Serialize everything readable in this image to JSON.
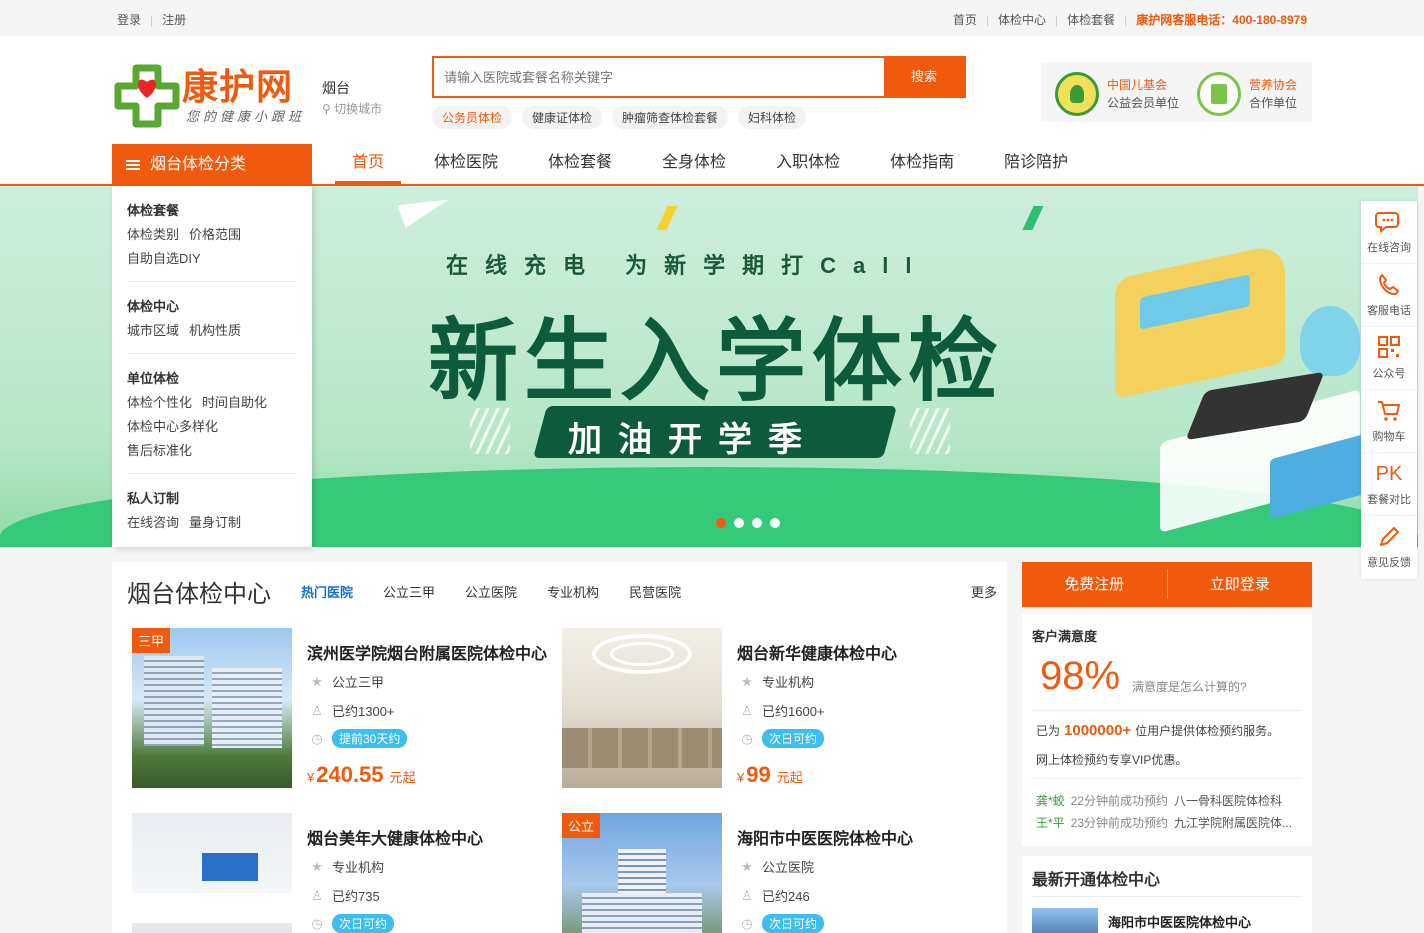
{
  "topbar": {
    "login": "登录",
    "register": "注册",
    "links": [
      "首页",
      "体检中心",
      "体检套餐"
    ],
    "hotline": "康护网客服电话：400-180-8979"
  },
  "header": {
    "logo_text": "康护网",
    "logo_slogan": "您的健康小跟班",
    "city": "烟台",
    "city_switch": "切换城市",
    "search_placeholder": "请输入医院或套餐名称关键字",
    "search_button": "搜索",
    "hot_tags": [
      "公务员体检",
      "健康证体检",
      "肿瘤筛查体检套餐",
      "妇科体检"
    ],
    "partners": [
      {
        "line1": "中国儿基会",
        "line2": "公益会员单位"
      },
      {
        "line1": "营养协会",
        "line2": "合作单位"
      }
    ]
  },
  "nav": {
    "category_title": "烟台体检分类",
    "items": [
      "首页",
      "体检医院",
      "体检套餐",
      "全身体检",
      "入职体检",
      "体检指南",
      "陪诊陪护"
    ]
  },
  "categories": [
    {
      "title": "体检套餐",
      "rows": [
        [
          "体检类别",
          "价格范围"
        ],
        [
          "自助自选DIY"
        ]
      ]
    },
    {
      "title": "体检中心",
      "rows": [
        [
          "城市区域",
          "机构性质"
        ]
      ]
    },
    {
      "title": "单位体检",
      "rows": [
        [
          "体检个性化",
          "时间自助化"
        ],
        [
          "体检中心多样化"
        ],
        [
          "售后标准化"
        ]
      ]
    },
    {
      "title": "私人订制",
      "rows": [
        [
          "在线咨询",
          "量身订制"
        ]
      ]
    }
  ],
  "banner": {
    "subtitle": "在线充电 为新学期打Call",
    "title": "新生入学体检",
    "ribbon": "加油开学季",
    "slide_count": 4,
    "active_slide": 1
  },
  "sidebar": [
    {
      "label": "在线咨询",
      "icon": "chat-icon"
    },
    {
      "label": "客服电话",
      "icon": "phone-icon"
    },
    {
      "label": "公众号",
      "icon": "qrcode-icon"
    },
    {
      "label": "购物车",
      "icon": "cart-icon"
    },
    {
      "label": "套餐对比",
      "icon": "pk-icon",
      "glyph": "PK"
    },
    {
      "label": "意见反馈",
      "icon": "pencil-icon"
    }
  ],
  "hospitals": {
    "title": "烟台体检中心",
    "tabs": [
      "热门医院",
      "公立三甲",
      "公立医院",
      "专业机构",
      "民营医院"
    ],
    "more": "更多",
    "cards": [
      {
        "badge": "三甲",
        "name": "滨州医学院烟台附属医院体检中心",
        "type": "公立三甲",
        "booked": "已约1300+",
        "availability": "提前30天约",
        "currency": "¥",
        "price": "240.55",
        "unit": "元起"
      },
      {
        "badge": "",
        "name": "烟台新华健康体检中心",
        "type": "专业机构",
        "booked": "已约1600+",
        "availability": "次日可约",
        "currency": "¥",
        "price": "99",
        "unit": "元起"
      },
      {
        "badge": "",
        "name": "烟台美年大健康体检中心",
        "type": "专业机构",
        "booked": "已约735",
        "availability": "次日可约",
        "currency": "¥",
        "price": "",
        "unit": ""
      },
      {
        "badge": "公立",
        "name": "海阳市中医医院体检中心",
        "type": "公立医院",
        "booked": "已约246",
        "availability": "次日可约",
        "currency": "¥",
        "price": "",
        "unit": ""
      }
    ]
  },
  "account": {
    "register": "免费注册",
    "login": "立即登录"
  },
  "satisfaction": {
    "title": "客户满意度",
    "percent": "98%",
    "how": "满意度是怎么计算的?",
    "served_prefix": "已为",
    "served_count": "1000000+",
    "served_suffix": "位用户提供体检预约服务。",
    "vip": "网上体检预约专享VIP优惠。",
    "bookings": [
      {
        "name": "龚*蛟",
        "time": "22分钟前成功预约",
        "hospital": "八一骨科医院体检科"
      },
      {
        "name": "王*平",
        "time": "23分钟前成功预约",
        "hospital": "九江学院附属医院体..."
      }
    ]
  },
  "newest": {
    "title": "最新开通体检中心",
    "first_name": "海阳市中医医院体检中心"
  },
  "colors": {
    "brand": "#f05a0e",
    "link_blue": "#1a6fd0",
    "pill_blue": "#3ebeea",
    "banner_green": "#0d5a3c"
  }
}
